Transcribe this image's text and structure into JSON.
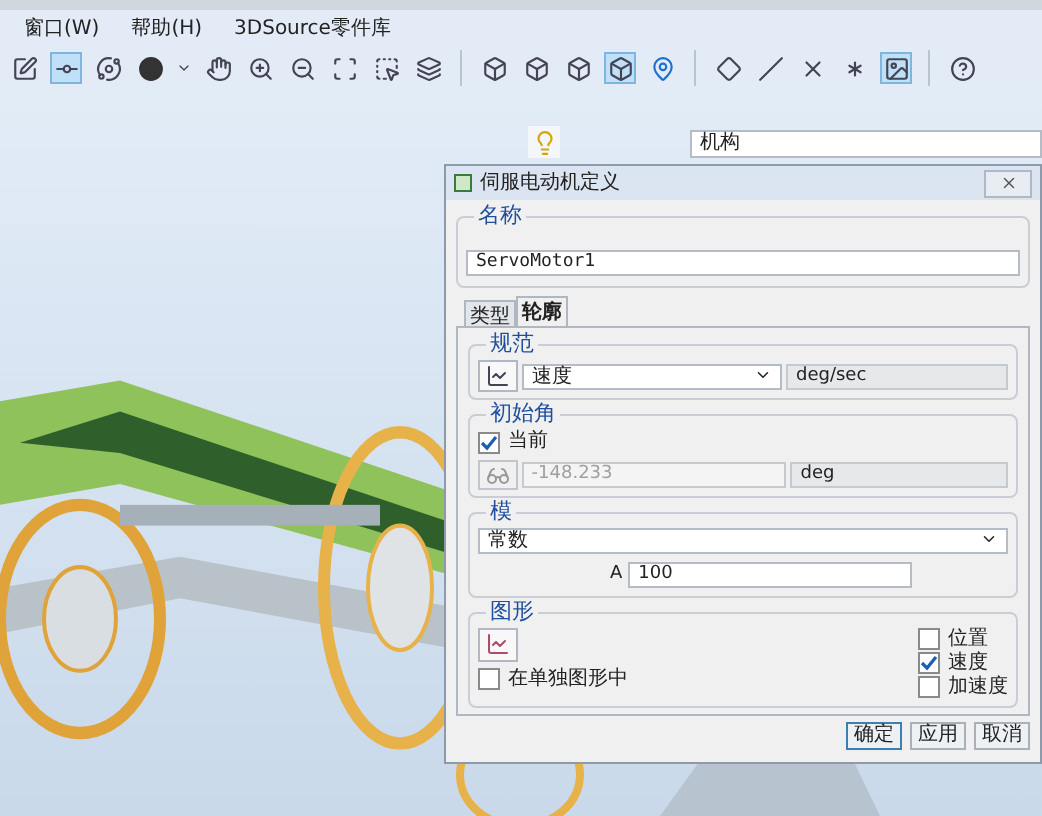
{
  "menu": [
    {
      "label": "窗口(W)"
    },
    {
      "label": "帮助(H)"
    },
    {
      "label": "3DSource零件库"
    }
  ],
  "view_bar": {
    "dropdown": "机构"
  },
  "dialog": {
    "title": "伺服电动机定义",
    "name_group": {
      "label": "名称",
      "value": "ServoMotor1"
    },
    "tabs": [
      {
        "label": "类型",
        "selected": false
      },
      {
        "label": "轮廓",
        "selected": true
      }
    ],
    "spec": {
      "label": "规范",
      "value": "速度",
      "unit": "deg/sec"
    },
    "initial_angle": {
      "label": "初始角",
      "current": {
        "label": "当前",
        "checked": true
      },
      "value": "-148.233",
      "unit": "deg",
      "disabled": true
    },
    "magnitude": {
      "label": "模",
      "value": "常数",
      "a_label": "A",
      "a_value": "100"
    },
    "graph": {
      "label": "图形",
      "separate": {
        "label": "在单独图形中",
        "checked": false
      },
      "options": [
        {
          "label": "位置",
          "checked": false
        },
        {
          "label": "速度",
          "checked": true
        },
        {
          "label": "加速度",
          "checked": false
        }
      ]
    },
    "buttons": [
      {
        "label": "确定",
        "selected": true
      },
      {
        "label": "应用",
        "selected": false
      },
      {
        "label": "取消",
        "selected": false
      }
    ]
  }
}
